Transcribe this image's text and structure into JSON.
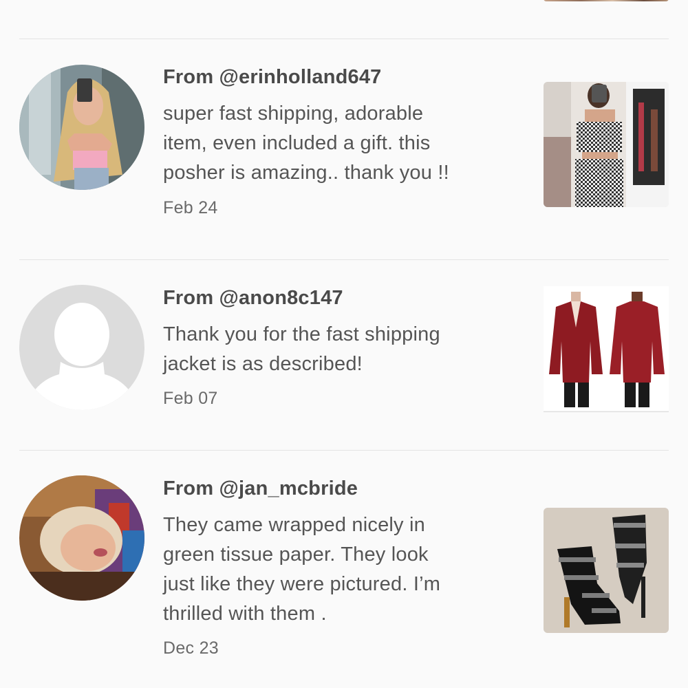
{
  "reviews": [
    {
      "from": "From @erinholland647",
      "comment_lines": [
        "super fast shipping, adorable",
        "item, even included a gift. this",
        "posher is amazing.. thank you !!"
      ],
      "date": "Feb 24",
      "avatar_icon": "user-photo-avatar",
      "item_icon": "checkered-outfit-photo"
    },
    {
      "from": "From @anon8c147",
      "comment_lines": [
        "Thank you for the fast shipping",
        "jacket is as described!"
      ],
      "date": "Feb 07",
      "avatar_icon": "default-silhouette-avatar",
      "item_icon": "red-jacket-photo"
    },
    {
      "from": "From @jan_mcbride",
      "comment_lines": [
        "They came wrapped nicely in",
        "green tissue paper. They look",
        "just like they were pictured. I’m",
        "thrilled with them ."
      ],
      "date": "Dec 23",
      "avatar_icon": "user-photo-avatar",
      "item_icon": "black-boots-photo"
    }
  ],
  "colors": {
    "background": "#fafafa",
    "divider": "#e3e3e3",
    "username": "#4a4a4a",
    "comment": "#555555",
    "date": "#6a6a6a"
  }
}
